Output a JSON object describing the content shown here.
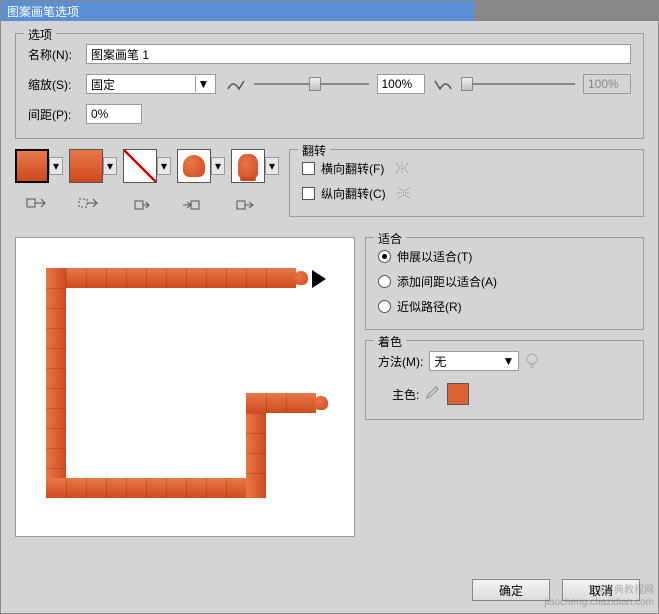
{
  "title": "图案画笔选项",
  "options": {
    "legend": "选项",
    "name_label": "名称(N):",
    "name_value": "图案画笔 1",
    "scale_label": "缩放(S):",
    "scale_mode": "固定",
    "scale_value": "100%",
    "scale_value2": "100%",
    "spacing_label": "间距(P):",
    "spacing_value": "0%"
  },
  "tiles": {
    "items": [
      "side-tile",
      "side-tile-2",
      "corner-tile",
      "start-tile",
      "end-tile"
    ]
  },
  "flip": {
    "legend": "翻转",
    "horizontal": "横向翻转(F)",
    "vertical": "纵向翻转(C)"
  },
  "fit": {
    "legend": "适合",
    "stretch": "伸展以适合(T)",
    "add_space": "添加间距以适合(A)",
    "approx": "近似路径(R)",
    "selected": "stretch"
  },
  "colorize": {
    "legend": "着色",
    "method_label": "方法(M):",
    "method_value": "无",
    "key_label": "主色:",
    "key_color": "#dc6433"
  },
  "buttons": {
    "ok": "确定",
    "cancel": "取消"
  },
  "watermark": {
    "line1": "查字典教程网",
    "line2": "jiaocheng.chazidian.com"
  }
}
